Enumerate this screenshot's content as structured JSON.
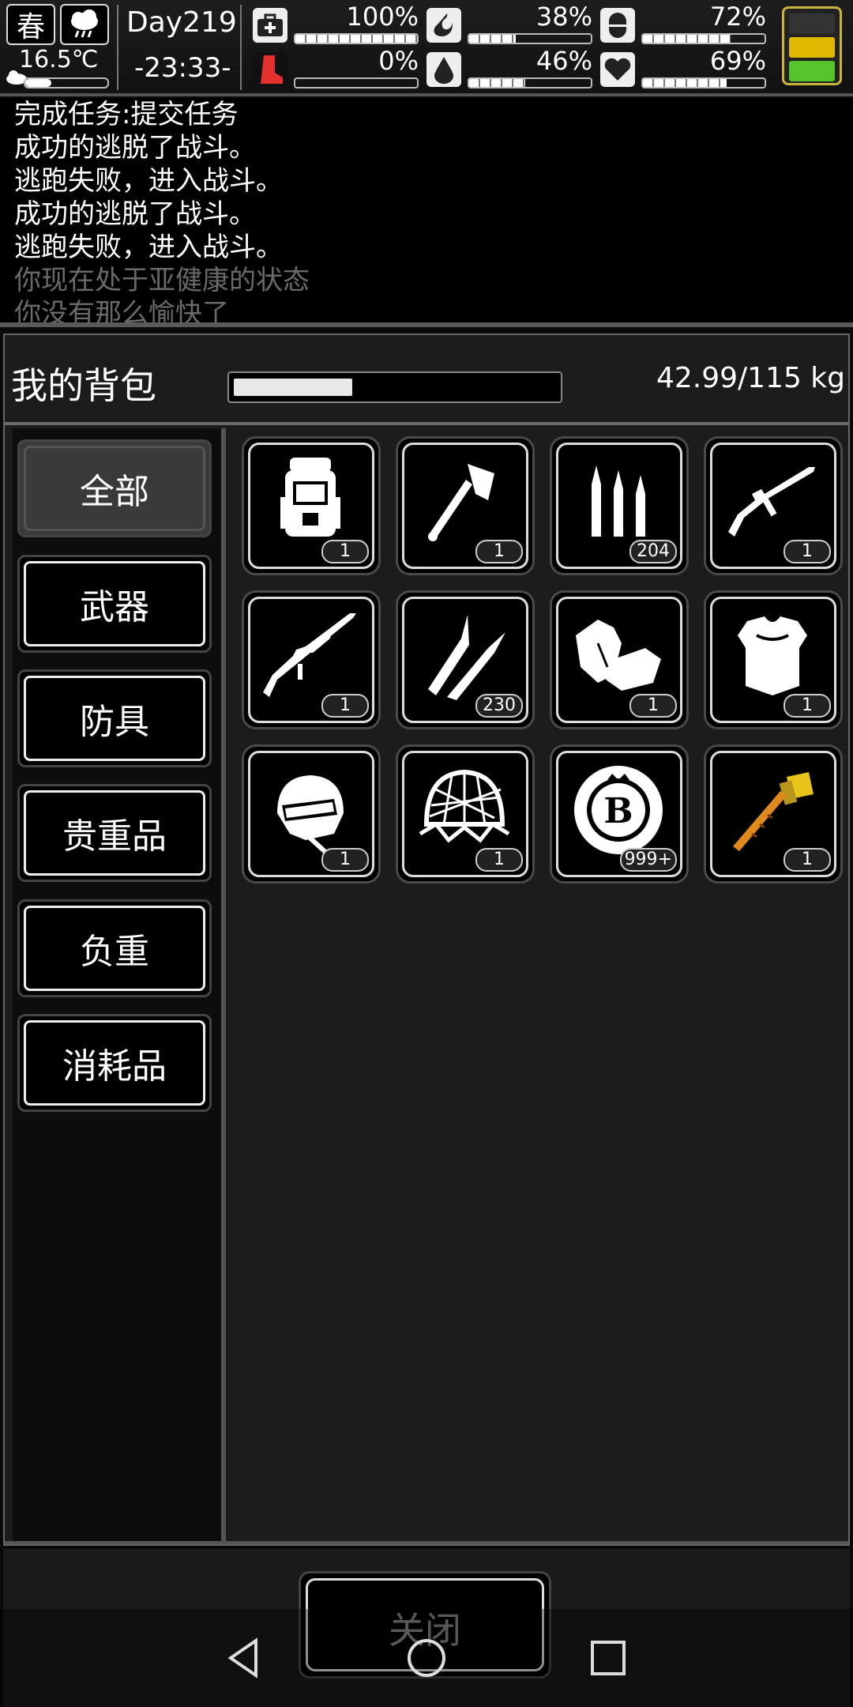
{
  "status": {
    "season": "春",
    "temperature": "16.5℃",
    "temperature_level": 0.32,
    "day": "Day219",
    "time": "-23:33-",
    "stats": [
      {
        "icon": "medkit-icon",
        "value": "100%",
        "level": 1.0
      },
      {
        "icon": "stomach-icon",
        "value": "38%",
        "level": 0.38
      },
      {
        "icon": "pill-icon",
        "value": "72%",
        "level": 0.72
      },
      {
        "icon": "injured-leg-icon",
        "value": "0%",
        "level": 0.0
      },
      {
        "icon": "water-drop-icon",
        "value": "46%",
        "level": 0.46
      },
      {
        "icon": "heart-icon",
        "value": "69%",
        "level": 0.69
      }
    ],
    "battery": {
      "colors": [
        "#333333",
        "#e0b800",
        "#55c42a"
      ]
    }
  },
  "log": {
    "lines": [
      "完成任务:提交任务",
      "成功的逃脱了战斗。",
      "逃跑失败，进入战斗。",
      "成功的逃脱了战斗。",
      "逃跑失败，进入战斗。",
      "你现在处于亚健康的状态",
      "你没有那么愉快了"
    ]
  },
  "bag": {
    "title": "我的背包",
    "weight": "42.99/115 kg",
    "weight_level": 0.37
  },
  "categories": [
    {
      "label": "全部",
      "active": true
    },
    {
      "label": "武器",
      "active": false
    },
    {
      "label": "防具",
      "active": false
    },
    {
      "label": "贵重品",
      "active": false
    },
    {
      "label": "负重",
      "active": false
    },
    {
      "label": "消耗品",
      "active": false
    }
  ],
  "items": [
    {
      "icon": "backpack-icon",
      "count": "1"
    },
    {
      "icon": "axe-icon",
      "count": "1"
    },
    {
      "icon": "bullets-icon",
      "count": "204"
    },
    {
      "icon": "assault-rifle-icon",
      "count": "1"
    },
    {
      "icon": "sniper-rifle-icon",
      "count": "1"
    },
    {
      "icon": "rifle-rounds-icon",
      "count": "230"
    },
    {
      "icon": "gloves-icon",
      "count": "1"
    },
    {
      "icon": "body-armor-icon",
      "count": "1"
    },
    {
      "icon": "helmet-icon",
      "count": "1"
    },
    {
      "icon": "net-helmet-icon",
      "count": "1"
    },
    {
      "icon": "coin-icon",
      "count": "999+"
    },
    {
      "icon": "hammer-icon",
      "count": "1"
    }
  ],
  "footer": {
    "close_label": "关闭"
  }
}
